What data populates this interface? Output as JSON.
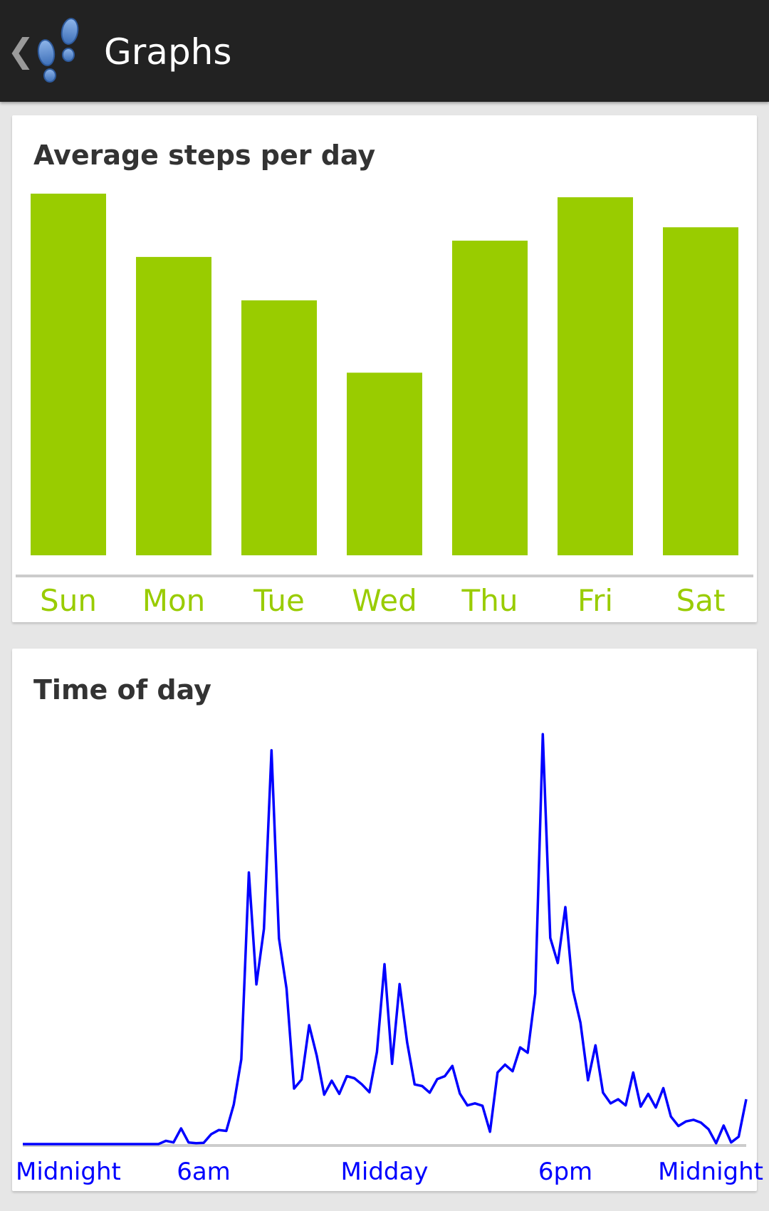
{
  "app": {
    "title": "Graphs",
    "back_glyph": "❮",
    "icon": "footprints-icon"
  },
  "colors": {
    "bar": "#99cc00",
    "line": "#0000ff",
    "axis": "#cccccc",
    "appbar": "#222222"
  },
  "chart_data": [
    {
      "type": "bar",
      "title": "Average steps per day",
      "categories": [
        "Sun",
        "Mon",
        "Tue",
        "Wed",
        "Thu",
        "Fri",
        "Sat"
      ],
      "values": [
        1.0,
        0.825,
        0.705,
        0.505,
        0.87,
        0.99,
        0.907
      ],
      "ylim": [
        0,
        1
      ],
      "grid": false
    },
    {
      "type": "line",
      "title": "Time of day",
      "x_labels": [
        "Midnight",
        "6am",
        "Midday",
        "6pm",
        "Midnight"
      ],
      "x_label_hours": [
        0,
        6,
        12,
        18,
        24
      ],
      "x_hours": [
        0,
        0.25,
        0.5,
        0.75,
        1,
        1.25,
        1.5,
        1.75,
        2,
        2.25,
        2.5,
        2.75,
        3,
        3.25,
        3.5,
        3.75,
        4,
        4.25,
        4.5,
        4.75,
        5,
        5.25,
        5.5,
        5.75,
        6,
        6.25,
        6.5,
        6.75,
        7,
        7.25,
        7.5,
        7.75,
        8,
        8.25,
        8.5,
        8.75,
        9,
        9.25,
        9.5,
        9.75,
        10,
        10.25,
        10.5,
        10.75,
        11,
        11.25,
        11.5,
        11.75,
        12,
        12.25,
        12.5,
        12.75,
        13,
        13.25,
        13.5,
        13.75,
        14,
        14.25,
        14.5,
        14.75,
        15,
        15.25,
        15.5,
        15.75,
        16,
        16.25,
        16.5,
        16.75,
        17,
        17.25,
        17.5,
        17.75,
        18,
        18.25,
        18.5,
        18.75,
        19,
        19.25,
        19.5,
        19.75,
        20,
        20.25,
        20.5,
        20.75,
        21,
        21.25,
        21.5,
        21.75,
        22,
        22.25,
        22.5,
        22.75,
        23,
        23.25,
        23.5,
        23.75,
        24
      ],
      "values": [
        0,
        0,
        0,
        0,
        0,
        0,
        0,
        0,
        0,
        0,
        0,
        0,
        0,
        0,
        0,
        0,
        0,
        0,
        0,
        0.008,
        0.004,
        0.038,
        0.004,
        0.002,
        0.003,
        0.024,
        0.034,
        0.032,
        0.096,
        0.206,
        0.66,
        0.388,
        0.523,
        0.957,
        0.5,
        0.378,
        0.135,
        0.157,
        0.289,
        0.215,
        0.12,
        0.154,
        0.122,
        0.165,
        0.16,
        0.145,
        0.126,
        0.224,
        0.437,
        0.195,
        0.389,
        0.247,
        0.145,
        0.141,
        0.125,
        0.158,
        0.165,
        0.19,
        0.123,
        0.094,
        0.099,
        0.093,
        0.03,
        0.174,
        0.193,
        0.177,
        0.235,
        0.222,
        0.366,
        0.996,
        0.501,
        0.44,
        0.576,
        0.374,
        0.295,
        0.155,
        0.24,
        0.125,
        0.099,
        0.109,
        0.094,
        0.174,
        0.091,
        0.122,
        0.089,
        0.136,
        0.067,
        0.044,
        0.055,
        0.059,
        0.052,
        0.036,
        0.002,
        0.045,
        0.004,
        0.018,
        0.109
      ],
      "ylim": [
        0,
        1
      ],
      "grid": false
    }
  ]
}
